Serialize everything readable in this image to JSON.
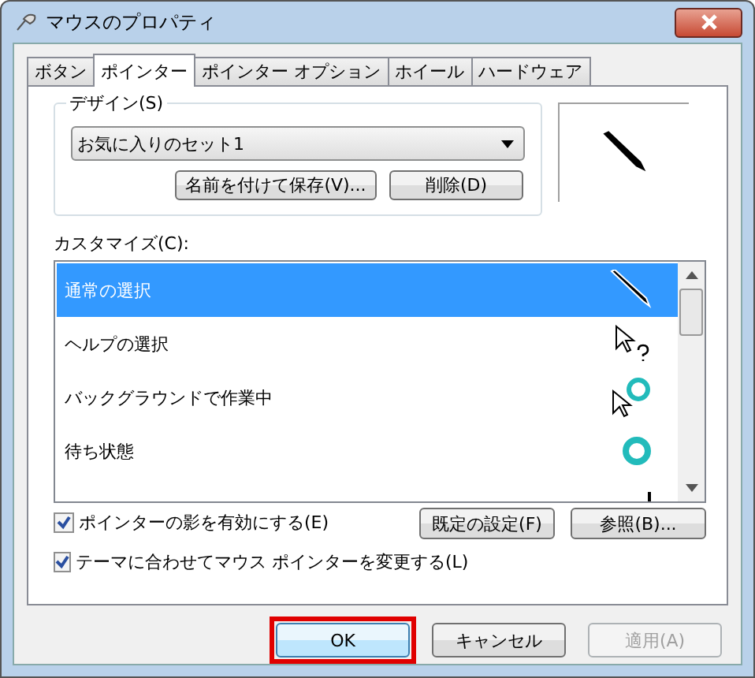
{
  "window": {
    "title": "マウスのプロパティ"
  },
  "tabs": [
    {
      "label": "ボタン",
      "selected": false
    },
    {
      "label": "ポインター",
      "selected": true
    },
    {
      "label": "ポインター オプション",
      "selected": false
    },
    {
      "label": "ホイール",
      "selected": false
    },
    {
      "label": "ハードウェア",
      "selected": false
    }
  ],
  "design": {
    "label": "デザイン(S)",
    "scheme": "お気に入りのセット1",
    "buttons": [
      "名前を付けて保存(V)...",
      "削除(D)"
    ]
  },
  "customize": {
    "label": "カスタマイズ(C):",
    "rows": [
      {
        "name": "通常の選択",
        "kind": "pen",
        "selected": true
      },
      {
        "name": "ヘルプの選択",
        "kind": "help",
        "selected": false
      },
      {
        "name": "バックグラウンドで作業中",
        "kind": "busy",
        "selected": false
      },
      {
        "name": "待ち状態",
        "kind": "wait",
        "selected": false
      },
      {
        "kind": "text",
        "selected": false
      }
    ]
  },
  "options": [
    {
      "label": "ポインターの影を有効にする(E)",
      "checked": true
    },
    {
      "label": "テーマに合わせてマウス ポインターを変更する(L)",
      "checked": true
    }
  ],
  "side_buttons": [
    "既定の設定(F)",
    "参照(B)..."
  ],
  "buttons": [
    {
      "label": "OK",
      "disabled": false,
      "highlighted": true
    },
    {
      "label": "キャンセル",
      "disabled": false,
      "highlighted": false
    },
    {
      "label": "適用(A)",
      "disabled": true,
      "highlighted": false
    }
  ]
}
